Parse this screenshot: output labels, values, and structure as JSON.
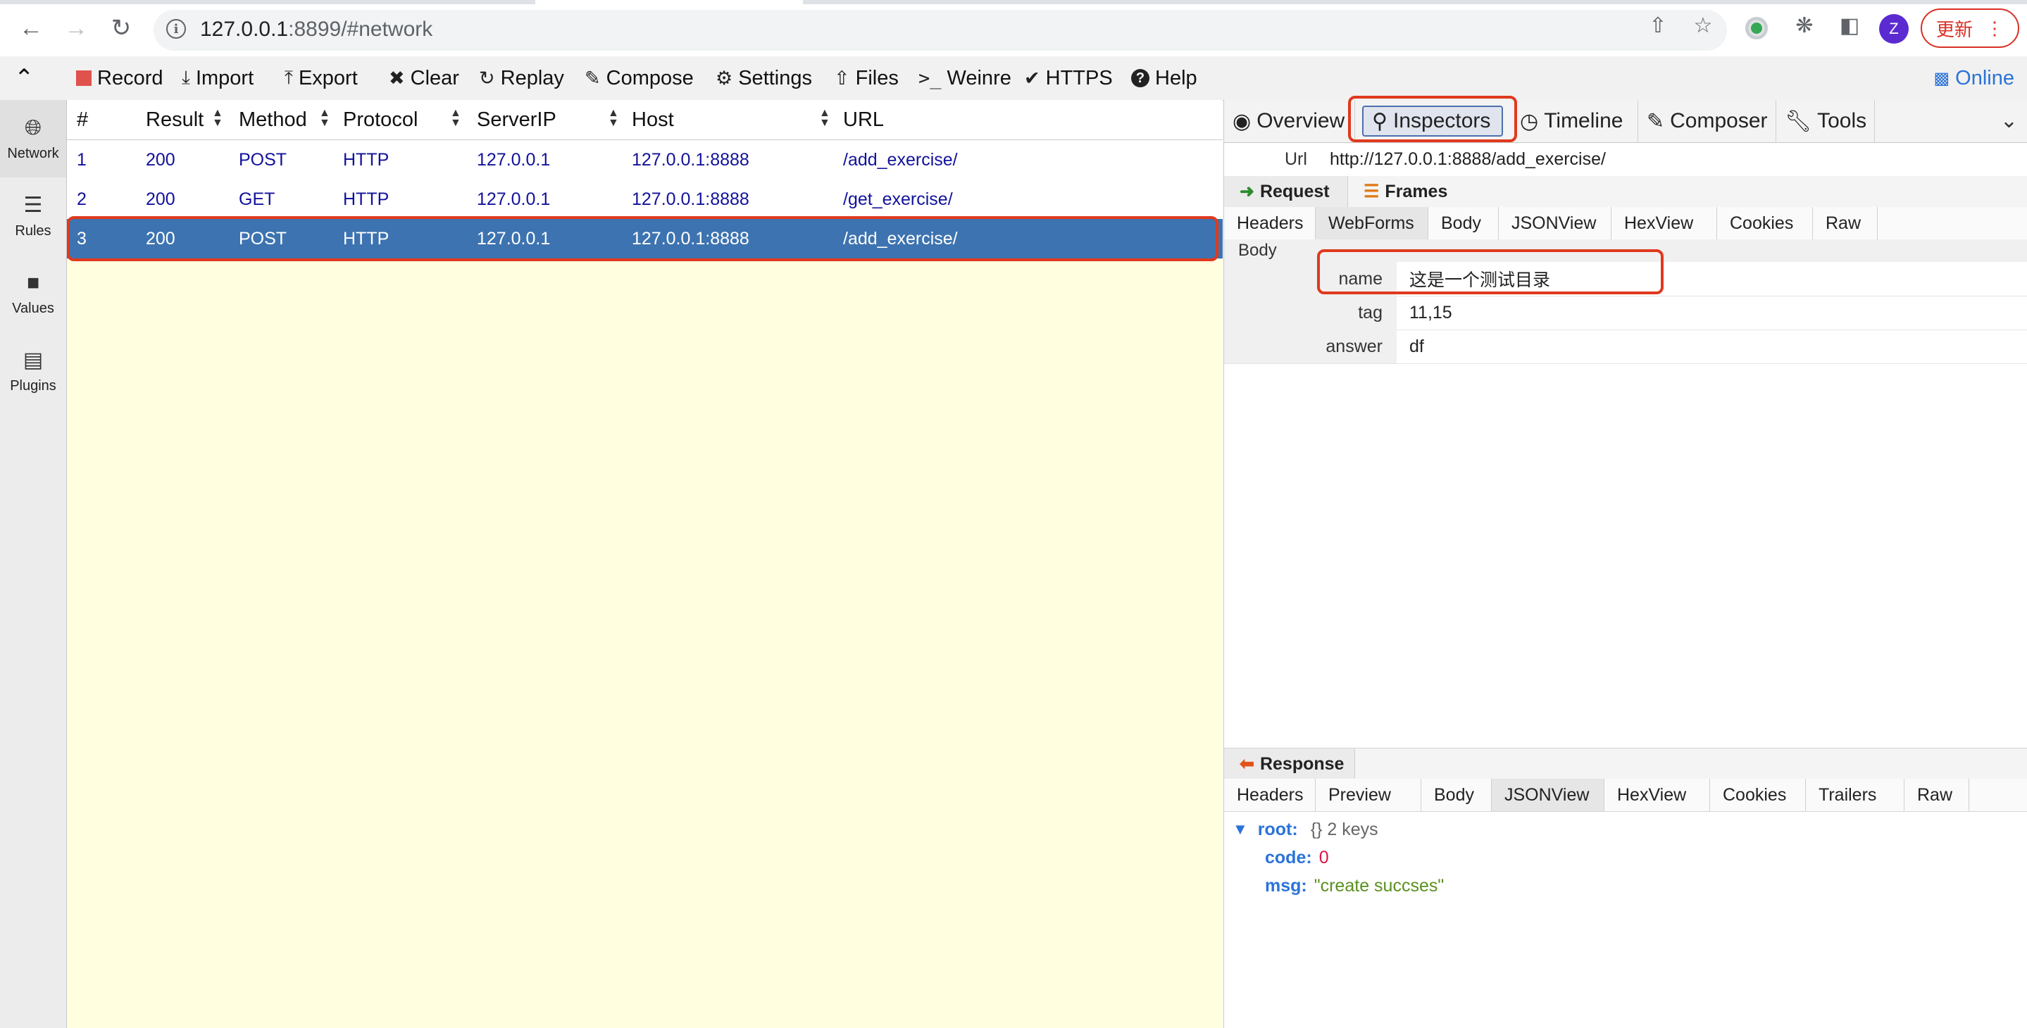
{
  "browser": {
    "url_host": "127.0.0.1",
    "url_rest": ":8899/#network",
    "avatar_letter": "Z",
    "update_label": "更新"
  },
  "toolbar": {
    "items": [
      {
        "label": "Record",
        "icon": "record-icon"
      },
      {
        "label": "Import",
        "icon": "import-icon"
      },
      {
        "label": "Export",
        "icon": "export-icon"
      },
      {
        "label": "Clear",
        "icon": "clear-icon"
      },
      {
        "label": "Replay",
        "icon": "replay-icon"
      },
      {
        "label": "Compose",
        "icon": "compose-icon"
      },
      {
        "label": "Settings",
        "icon": "gear-icon"
      },
      {
        "label": "Files",
        "icon": "upload-icon"
      },
      {
        "label": "Weinre",
        "icon": "terminal-icon"
      },
      {
        "label": "HTTPS",
        "icon": "check-icon"
      },
      {
        "label": "Help",
        "icon": "help-icon"
      }
    ],
    "online_label": "Online"
  },
  "sidebar": {
    "items": [
      {
        "label": "Network",
        "icon": "globe-icon"
      },
      {
        "label": "Rules",
        "icon": "list-icon"
      },
      {
        "label": "Values",
        "icon": "folder-icon"
      },
      {
        "label": "Plugins",
        "icon": "plugin-icon"
      }
    ]
  },
  "network": {
    "columns": [
      "#",
      "Result",
      "Method",
      "Protocol",
      "ServerIP",
      "Host",
      "URL"
    ],
    "rows": [
      {
        "num": "1",
        "result": "200",
        "method": "POST",
        "protocol": "HTTP",
        "server_ip": "127.0.0.1",
        "host": "127.0.0.1:8888",
        "url": "/add_exercise/"
      },
      {
        "num": "2",
        "result": "200",
        "method": "GET",
        "protocol": "HTTP",
        "server_ip": "127.0.0.1",
        "host": "127.0.0.1:8888",
        "url": "/get_exercise/"
      },
      {
        "num": "3",
        "result": "200",
        "method": "POST",
        "protocol": "HTTP",
        "server_ip": "127.0.0.1",
        "host": "127.0.0.1:8888",
        "url": "/add_exercise/"
      }
    ],
    "selected_row": 3
  },
  "inspector": {
    "tabs": [
      "Overview",
      "Inspectors",
      "Timeline",
      "Composer",
      "Tools"
    ],
    "active_tab": "Inspectors",
    "url_label": "Url",
    "url_value": "http://127.0.0.1:8888/add_exercise/",
    "request": {
      "label": "Request",
      "frames_label": "Frames",
      "tabs": [
        "Headers",
        "WebForms",
        "Body",
        "JSONView",
        "HexView",
        "Cookies",
        "Raw"
      ],
      "active_tab": "WebForms",
      "body_label": "Body",
      "fields": [
        {
          "key": "name",
          "value": "这是一个测试目录"
        },
        {
          "key": "tag",
          "value": "11,15"
        },
        {
          "key": "answer",
          "value": "df"
        }
      ]
    },
    "response": {
      "label": "Response",
      "tabs": [
        "Headers",
        "Preview",
        "Body",
        "JSONView",
        "HexView",
        "Cookies",
        "Trailers",
        "Raw"
      ],
      "active_tab": "JSONView",
      "json": {
        "root_key": "root:",
        "root_meta": "{}  2 keys",
        "entries": [
          {
            "key": "code:",
            "value": "0",
            "type": "number"
          },
          {
            "key": "msg:",
            "value": "\"create succses\"",
            "type": "string"
          }
        ]
      }
    }
  },
  "colors": {
    "selected_row": "#3d73b0",
    "highlight_box": "#e0391e",
    "row_text": "#12129b",
    "empty_area": "#ffffe0"
  }
}
